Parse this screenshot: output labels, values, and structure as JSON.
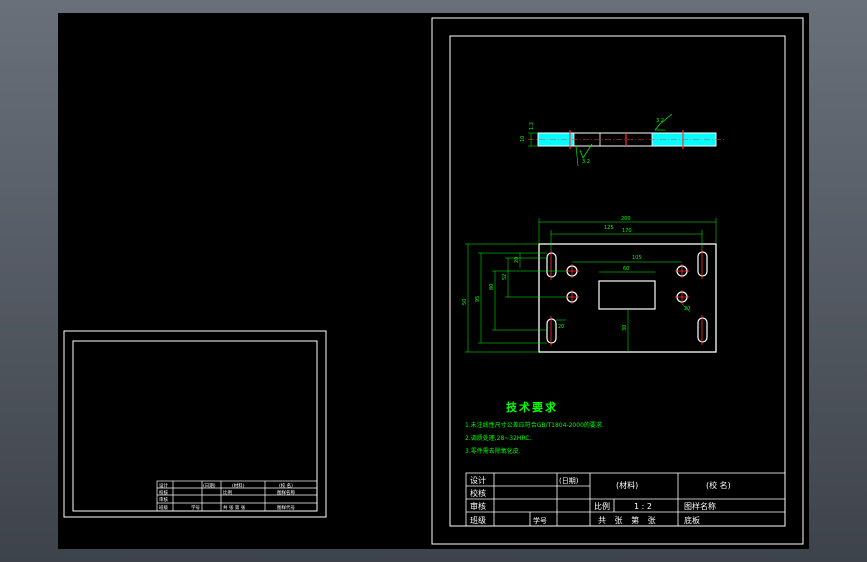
{
  "drawing": {
    "views": {
      "top_dims": [
        "1.3",
        "3.2",
        "10",
        "3.2"
      ],
      "plan_dims": [
        "200",
        "170",
        "105",
        "60",
        "30",
        "20",
        "50",
        "95",
        "80",
        "52",
        "125",
        "20",
        "20"
      ]
    },
    "tech": {
      "title": "技术要求",
      "notes": [
        "1.未注线性尺寸公差应符合GB/T1804-2000的要求.",
        "2.调质处理,28~32HRC.",
        "3.零件需去除氧化皮."
      ]
    },
    "title_block": {
      "design": "设计",
      "check": "校核",
      "review": "审核",
      "class": "班级",
      "date": "(日期)",
      "student_no": "学号",
      "material": "(材料)",
      "school": "(校 名)",
      "scale_label": "比例",
      "scale_value": "1 : 2",
      "drawing_name": "图样名称",
      "sheets": "共  张 第  张",
      "part_name": "底板"
    },
    "small_block": {
      "design": "设计",
      "check": "校核",
      "review": "审核",
      "class": "班级",
      "date": "(日期)",
      "material": "(材料)",
      "school": "(校 名)",
      "scale_label": "比例",
      "drawing_name": "图样名称",
      "sheets": "共 张 第 张",
      "student_no": "学号",
      "code": "图样代号"
    }
  }
}
